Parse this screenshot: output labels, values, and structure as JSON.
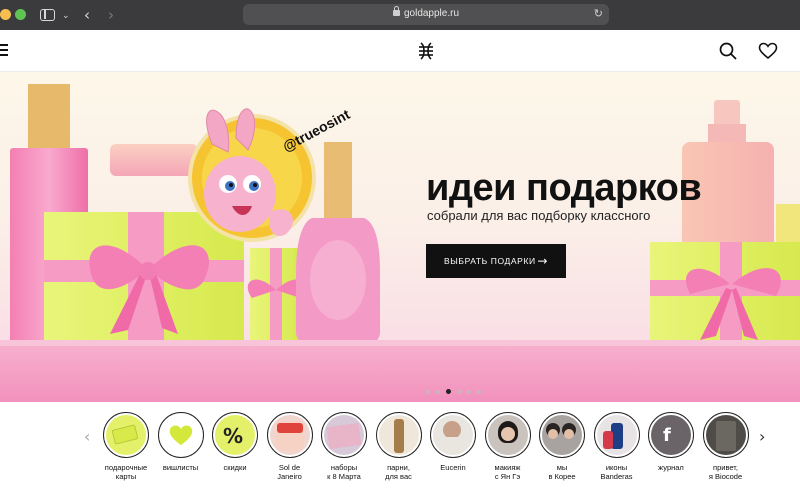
{
  "browser": {
    "url": "goldapple.ru",
    "reload_icon": "reload-icon",
    "back_icon": "back-arrow-icon",
    "forward_icon": "forward-arrow-icon"
  },
  "header": {
    "menu_icon": "hamburger-menu-icon",
    "logo_icon": "goldapple-logo-icon",
    "search_icon": "search-icon",
    "favorites_icon": "heart-icon"
  },
  "banner": {
    "headline": "идеи подарков",
    "subline": "собрали для вас подборку классного",
    "cta_label": "ВЫБРАТЬ ПОДАРКИ",
    "cta_arrow": "→",
    "watermark": "@trueosint",
    "carousel_total": 6,
    "carousel_active": 3
  },
  "stories": {
    "prev_arrow": "‹",
    "next_arrow": "›",
    "items": [
      {
        "line1": "подарочные",
        "line2": "карты",
        "thumb_color": "#e4f06a",
        "icon": "gift-card-icon"
      },
      {
        "line1": "вишлисты",
        "line2": "",
        "thumb_color": "#ffffff",
        "icon": "heart-icon"
      },
      {
        "line1": "скидки",
        "line2": "",
        "thumb_color": "#e4f06a",
        "icon": "percent-icon"
      },
      {
        "line1": "Sol de",
        "line2": "Janeiro",
        "thumb_color": "#f0d6cf",
        "icon": "product-jar-icon"
      },
      {
        "line1": "наборы",
        "line2": "к 8 Марта",
        "thumb_color": "#d7c9d8",
        "icon": "gift-set-icon"
      },
      {
        "line1": "парни,",
        "line2": "для вас",
        "thumb_color": "#efe7da",
        "icon": "product-bottle-icon"
      },
      {
        "line1": "Eucerin",
        "line2": "",
        "thumb_color": "#e9e6e1",
        "icon": "person-photo-icon"
      },
      {
        "line1": "макияж",
        "line2": "с Ян Гэ",
        "thumb_color": "#c9c2bd",
        "icon": "person-photo-icon"
      },
      {
        "line1": "мы",
        "line2": "в Корее",
        "thumb_color": "#a8a3a0",
        "icon": "person-photo-icon"
      },
      {
        "line1": "иконы",
        "line2": "Banderas",
        "thumb_color": "#e8e4e6",
        "icon": "perfume-icon"
      },
      {
        "line1": "журнал",
        "line2": "",
        "thumb_color": "#6a6468",
        "icon": "journal-icon"
      },
      {
        "line1": "привет,",
        "line2": "я Biocode",
        "thumb_color": "#4f4c48",
        "icon": "product-box-icon"
      }
    ]
  }
}
